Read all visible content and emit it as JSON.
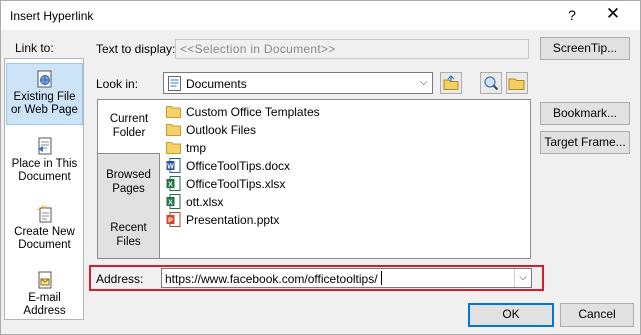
{
  "window": {
    "title": "Insert Hyperlink",
    "help": "?",
    "close": "✕"
  },
  "link_to": {
    "label": "Link to:",
    "items": [
      {
        "label1": "Existing File",
        "label2": "or Web Page",
        "icon": "globe-page-icon",
        "selected": true
      },
      {
        "label1": "Place in This",
        "label2": "Document",
        "icon": "document-place-icon"
      },
      {
        "label1": "Create New",
        "label2": "Document",
        "icon": "new-document-icon"
      },
      {
        "label1": "E-mail",
        "label2": "Address",
        "icon": "email-icon"
      }
    ]
  },
  "text_to_display": {
    "label": "Text to display:",
    "value": "<<Selection in Document>>"
  },
  "look_in": {
    "label": "Look in:",
    "value": "Documents"
  },
  "nav": [
    {
      "label1": "Current",
      "label2": "Folder",
      "selected": true
    },
    {
      "label1": "Browsed",
      "label2": "Pages"
    },
    {
      "label1": "Recent",
      "label2": "Files"
    }
  ],
  "files": [
    {
      "name": "Custom Office Templates",
      "type": "folder"
    },
    {
      "name": "Outlook Files",
      "type": "folder"
    },
    {
      "name": "tmp",
      "type": "folder"
    },
    {
      "name": "OfficeToolTips.docx",
      "type": "word"
    },
    {
      "name": "OfficeToolTips.xlsx",
      "type": "excel"
    },
    {
      "name": "ott.xlsx",
      "type": "excel"
    },
    {
      "name": "Presentation.pptx",
      "type": "powerpoint"
    }
  ],
  "address": {
    "label": "Address:",
    "value": "https://www.facebook.com/officetooltips/"
  },
  "buttons": {
    "screentip": "ScreenTip...",
    "bookmark": "Bookmark...",
    "target_frame": "Target Frame...",
    "ok": "OK",
    "cancel": "Cancel"
  },
  "colors": {
    "accent": "#0078d7",
    "highlight_border": "#d21f2b",
    "selection": "#cde3f7"
  }
}
